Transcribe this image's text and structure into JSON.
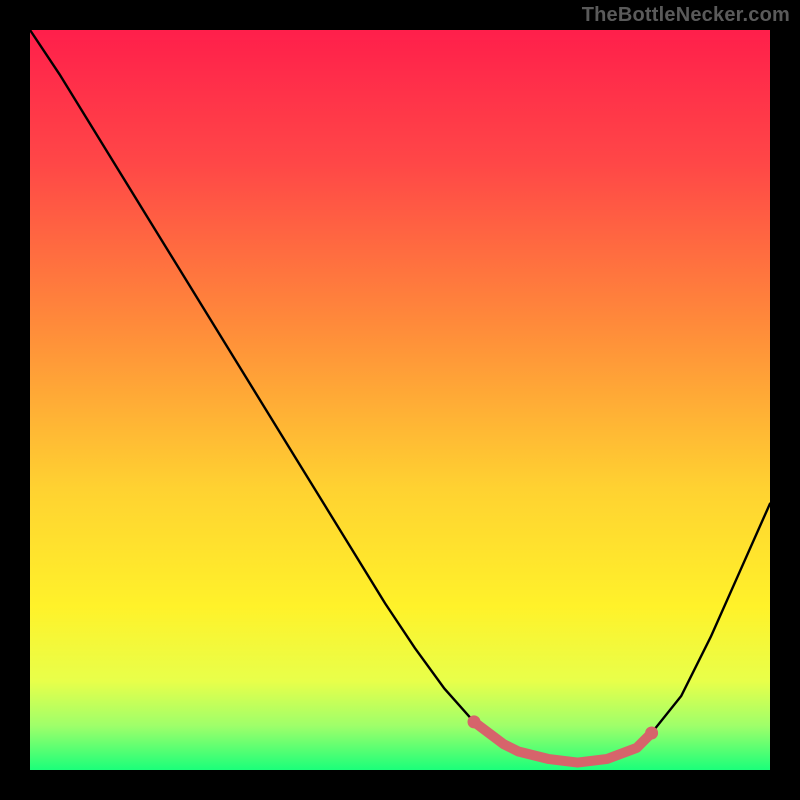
{
  "watermark": "TheBottleNecker.com",
  "chart_data": {
    "type": "line",
    "title": "",
    "xlabel": "",
    "ylabel": "",
    "xlim": [
      0,
      100
    ],
    "ylim": [
      0,
      100
    ],
    "gradient_stops": [
      {
        "offset": 0,
        "color": "#ff1f4b"
      },
      {
        "offset": 18,
        "color": "#ff4747"
      },
      {
        "offset": 40,
        "color": "#ff8b3a"
      },
      {
        "offset": 62,
        "color": "#ffd231"
      },
      {
        "offset": 78,
        "color": "#fff22a"
      },
      {
        "offset": 88,
        "color": "#e8ff4a"
      },
      {
        "offset": 94,
        "color": "#9fff6a"
      },
      {
        "offset": 100,
        "color": "#1bff7a"
      }
    ],
    "series": [
      {
        "name": "bottleneck-curve",
        "color": "#000000",
        "x": [
          0,
          4,
          8,
          12,
          16,
          20,
          24,
          28,
          32,
          36,
          40,
          44,
          48,
          52,
          56,
          60,
          62,
          64,
          66,
          70,
          74,
          78,
          82,
          84,
          88,
          92,
          96,
          100
        ],
        "y": [
          100,
          94,
          87.5,
          81,
          74.5,
          68,
          61.5,
          55,
          48.5,
          42,
          35.5,
          29,
          22.5,
          16.5,
          11,
          6.5,
          5,
          3.5,
          2.5,
          1.5,
          1,
          1.5,
          3,
          5,
          10,
          18,
          27,
          36
        ]
      }
    ],
    "highlight_band": {
      "name": "optimal-range",
      "color": "#d6646b",
      "x": [
        60,
        62,
        64,
        66,
        70,
        74,
        78,
        82,
        84
      ],
      "y": [
        6.5,
        5,
        3.5,
        2.5,
        1.5,
        1,
        1.5,
        3,
        5
      ]
    }
  }
}
